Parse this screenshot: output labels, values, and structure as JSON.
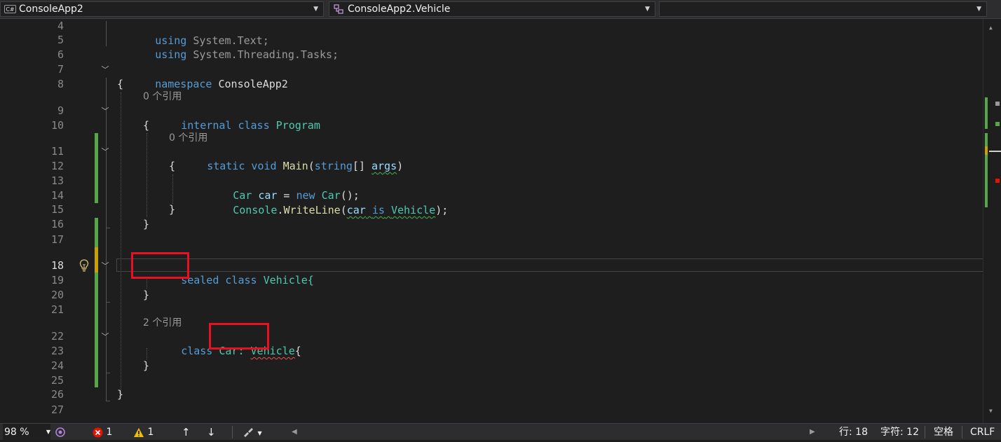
{
  "top_bar": {
    "project_dropdown": "ConsoleApp2",
    "project_icon_text": "C#",
    "type_dropdown": "ConsoleApp2.Vehicle",
    "member_dropdown": ""
  },
  "editor": {
    "lines": [
      {
        "n": "4"
      },
      {
        "n": "5"
      },
      {
        "n": "6"
      },
      {
        "n": "7"
      },
      {
        "n": "8"
      },
      {
        "n": "9"
      },
      {
        "n": "10"
      },
      {
        "n": "11"
      },
      {
        "n": "12"
      },
      {
        "n": "13"
      },
      {
        "n": "14"
      },
      {
        "n": "15"
      },
      {
        "n": "16"
      },
      {
        "n": "17"
      },
      {
        "n": "18"
      },
      {
        "n": "19"
      },
      {
        "n": "20"
      },
      {
        "n": "21"
      },
      {
        "n": "22"
      },
      {
        "n": "23"
      },
      {
        "n": "24"
      },
      {
        "n": "25"
      },
      {
        "n": "26"
      },
      {
        "n": "27"
      }
    ],
    "codelens": {
      "program_refs": "0 个引用",
      "main_refs": "0 个引用",
      "car_refs": "2 个引用"
    },
    "tokens": {
      "using": "using",
      "system_text": "System.Text;",
      "system": "System",
      "threading": ".Threading.",
      "tasks": "Tasks;",
      "namespace": "namespace",
      "ns_name": "ConsoleApp2",
      "open_brace": "{",
      "close_brace": "}",
      "internal": "internal",
      "class": "class",
      "program": "Program",
      "static": "static",
      "void": "void",
      "main": "Main",
      "open_paren": "(",
      "string": "string",
      "brackets": "[] ",
      "args": "args",
      "close_paren": ")",
      "car_type": "Car",
      "car_var": "car",
      "assign": " = ",
      "new": "new",
      "ctor_tail": "();",
      "console": "Console",
      "dot": ".",
      "writeline": "WriteLine",
      "is": "is",
      "vehicle": "Vehicle",
      "paren_semi": ");",
      "sealed": "sealed",
      "vehicle_brace": "Vehicle{",
      "car_colon": "Car:",
      "brace_open_inline": "{"
    }
  },
  "status_bar": {
    "zoom": "98 %",
    "errors": "1",
    "warnings": "1",
    "line": "行: 18",
    "char": "字符: 12",
    "spaces": "空格",
    "eol": "CRLF"
  },
  "colors": {
    "background": "#1e1e1e",
    "keyword": "#569cd6",
    "type": "#4ec9b0",
    "method": "#dcdcaa",
    "identifier": "#9cdcfe",
    "highlight_box": "#e81123",
    "change_bar": "#57a64a"
  },
  "icons": [
    "csharp-project-icon",
    "class-icon",
    "chevron-down-icon",
    "fold-icon",
    "lightbulb-icon",
    "error-icon",
    "warning-icon",
    "arrow-up-icon",
    "arrow-down-icon",
    "brush-icon"
  ]
}
